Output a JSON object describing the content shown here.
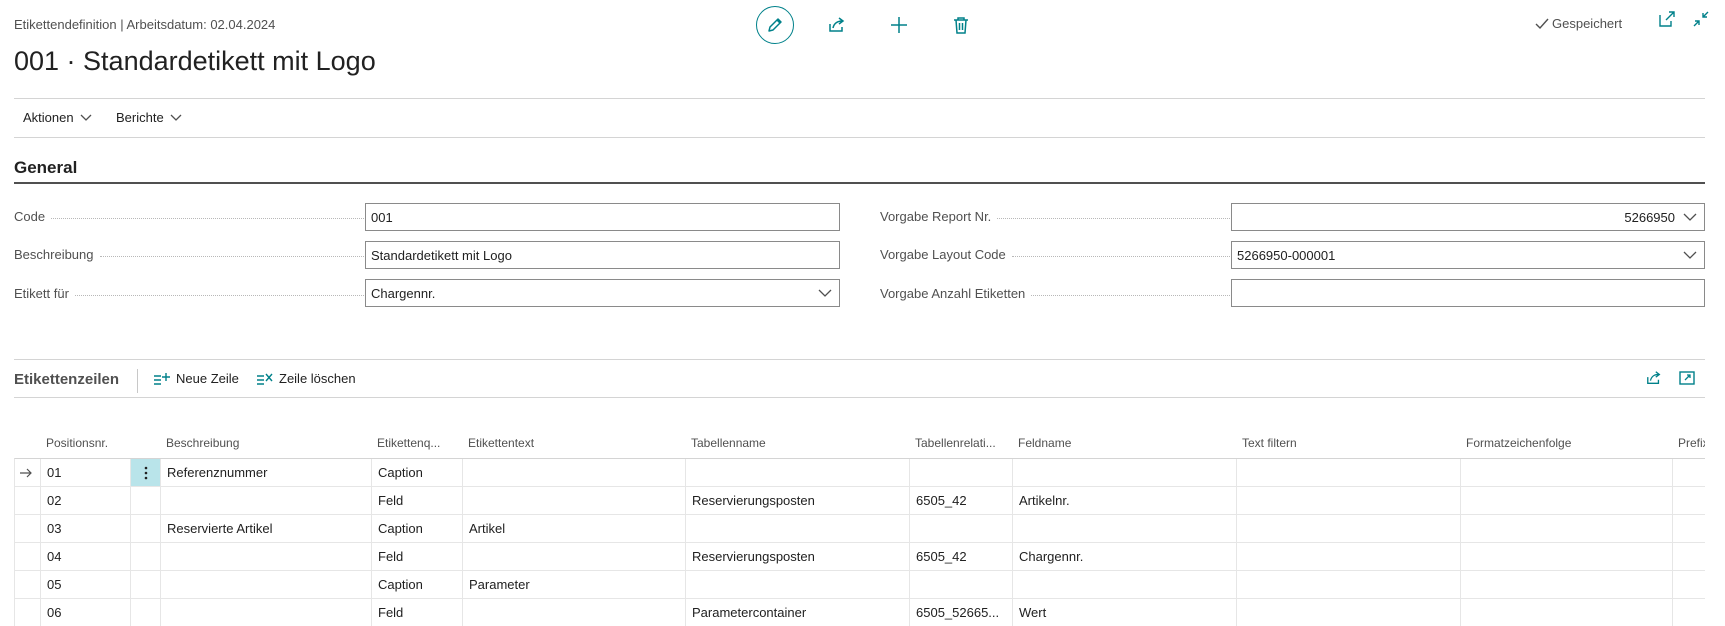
{
  "header": {
    "caption": "Etikettendefinition | Arbeitsdatum: 02.04.2024",
    "title": "001 · Standardetikett mit Logo",
    "saved_label": "Gespeichert"
  },
  "menu": {
    "actions_label": "Aktionen",
    "reports_label": "Berichte"
  },
  "general": {
    "title": "General",
    "fields": {
      "code": {
        "label": "Code",
        "value": "001"
      },
      "beschreibung": {
        "label": "Beschreibung",
        "value": "Standardetikett mit Logo"
      },
      "etikett_fuer": {
        "label": "Etikett für",
        "value": "Chargennr."
      },
      "vorgabe_report": {
        "label": "Vorgabe Report Nr.",
        "value": "5266950"
      },
      "vorgabe_layout": {
        "label": "Vorgabe Layout Code",
        "value": "5266950-000001"
      },
      "vorgabe_anzahl": {
        "label": "Vorgabe Anzahl Etiketten",
        "value": ""
      }
    }
  },
  "lines": {
    "title": "Etikettenzeilen",
    "new_line_label": "Neue Zeile",
    "delete_line_label": "Zeile löschen",
    "columns": [
      "Positionsnr.",
      "Beschreibung",
      "Etikettenq...",
      "Etikettentext",
      "Tabellenname",
      "Tabellenrelati...",
      "Feldname",
      "Text filtern",
      "Formatzeichenfolge",
      "Prefix"
    ],
    "rows": [
      [
        "01",
        "Referenznummer",
        "Caption",
        "",
        "",
        "",
        "",
        "",
        "",
        ""
      ],
      [
        "02",
        "",
        "Feld",
        "",
        "Reservierungsposten",
        "6505_42",
        "Artikelnr.",
        "",
        "",
        ""
      ],
      [
        "03",
        "Reservierte Artikel",
        "Caption",
        "Artikel",
        "",
        "",
        "",
        "",
        "",
        ""
      ],
      [
        "04",
        "",
        "Feld",
        "",
        "Reservierungsposten",
        "6505_42",
        "Chargennr.",
        "",
        "",
        ""
      ],
      [
        "05",
        "",
        "Caption",
        "Parameter",
        "",
        "",
        "",
        "",
        "",
        ""
      ],
      [
        "06",
        "",
        "Feld",
        "",
        "Parametercontainer",
        "6505_52665...",
        "Wert",
        "",
        "",
        ""
      ]
    ]
  },
  "colors": {
    "accent": "#00818a",
    "selected_cell": "#b9e4ea"
  }
}
